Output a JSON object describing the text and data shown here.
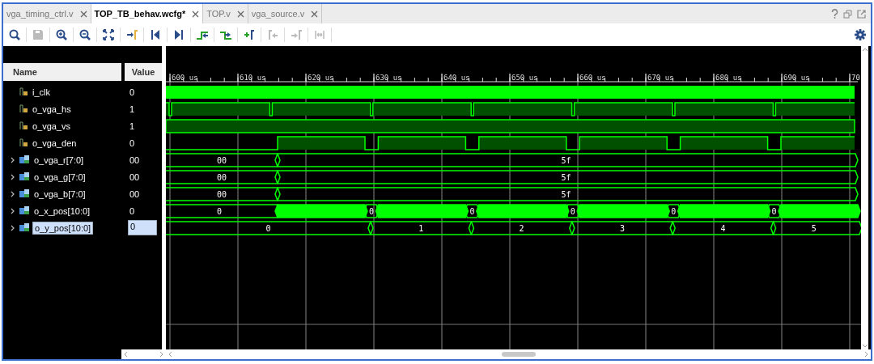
{
  "tabs": [
    {
      "label": "vga_timing_ctrl.v",
      "selected": false
    },
    {
      "label": "TOP_TB_behav.wcfg*",
      "selected": true
    },
    {
      "label": "TOP.v",
      "selected": false
    },
    {
      "label": "vga_source.v",
      "selected": false
    }
  ],
  "toolbar": [
    {
      "kind": "search",
      "disabled": false
    },
    {
      "kind": "save",
      "disabled": true
    },
    {
      "kind": "zoom-in",
      "disabled": false
    },
    {
      "kind": "zoom-out",
      "disabled": false
    },
    {
      "kind": "zoom-fit",
      "disabled": false
    },
    {
      "kind": "go-to-cursor",
      "disabled": false
    },
    {
      "kind": "go-to-start",
      "disabled": false
    },
    {
      "kind": "go-to-end",
      "disabled": false
    },
    {
      "kind": "prev-transition",
      "disabled": false
    },
    {
      "kind": "next-transition",
      "disabled": false
    },
    {
      "kind": "add-marker",
      "disabled": false
    },
    {
      "kind": "prev-marker",
      "disabled": true
    },
    {
      "kind": "next-marker",
      "disabled": true
    },
    {
      "kind": "swap-cursors",
      "disabled": true
    }
  ],
  "columns": {
    "name": "Name",
    "value": "Value"
  },
  "ruler": [
    "600 us",
    "610 us",
    "620 us",
    "630 us",
    "640 us",
    "650 us",
    "660 us",
    "670 us",
    "680 us",
    "690 us",
    "70"
  ],
  "signals": [
    {
      "name": "i_clk",
      "value": "0",
      "kind": "clock",
      "selected": false
    },
    {
      "name": "o_vga_hs",
      "value": "1",
      "kind": "pulse",
      "selected": false
    },
    {
      "name": "o_vga_vs",
      "value": "1",
      "kind": "high",
      "selected": false
    },
    {
      "name": "o_vga_den",
      "value": "0",
      "kind": "enable",
      "selected": false
    },
    {
      "name": "o_vga_r[7:0]",
      "value": "00",
      "kind": "step",
      "expanded": false,
      "selected": false,
      "segments": [
        "00",
        "5f"
      ]
    },
    {
      "name": "o_vga_g[7:0]",
      "value": "00",
      "kind": "step",
      "expanded": false,
      "selected": false,
      "segments": [
        "00",
        "5f"
      ]
    },
    {
      "name": "o_vga_b[7:0]",
      "value": "00",
      "kind": "step",
      "expanded": false,
      "selected": false,
      "segments": [
        "00",
        "5f"
      ]
    },
    {
      "name": "o_x_pos[10:0]",
      "value": "0",
      "kind": "counter",
      "expanded": false,
      "selected": false,
      "segments": [
        "0",
        "0",
        "0",
        "0",
        "0",
        "0"
      ]
    },
    {
      "name": "o_y_pos[10:0]",
      "value": "0",
      "kind": "line",
      "expanded": false,
      "selected": true,
      "segments": [
        "0",
        "1",
        "2",
        "3",
        "4",
        "5"
      ]
    }
  ]
}
